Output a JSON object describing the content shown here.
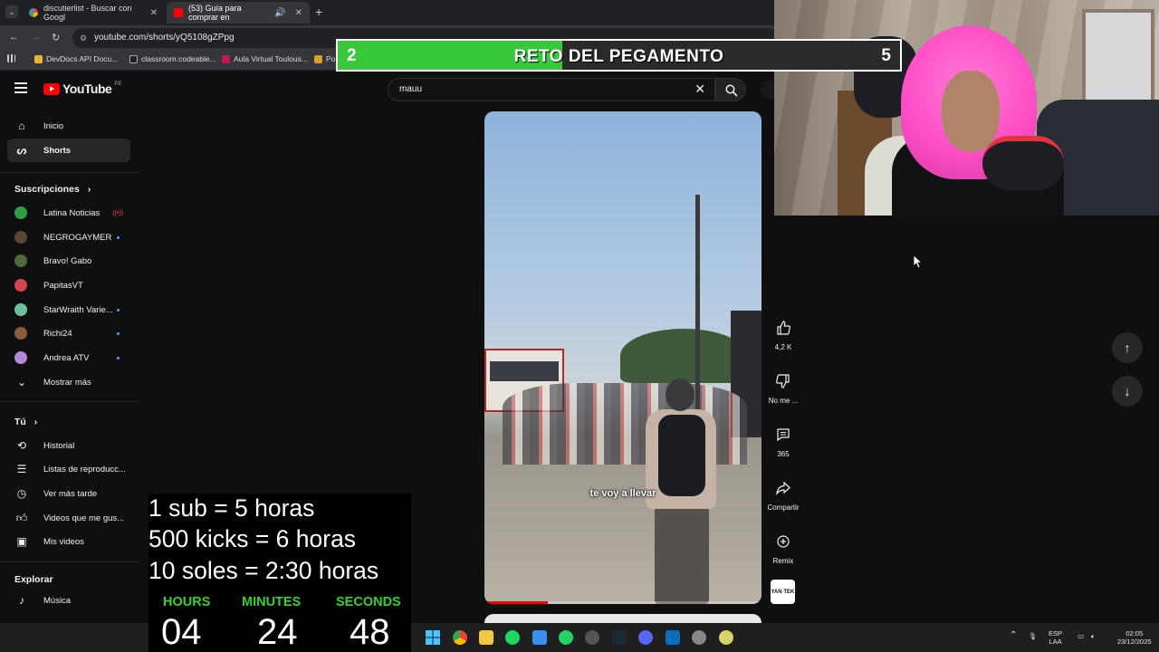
{
  "browser": {
    "tabs": [
      {
        "title": "discutierlist - Buscar con Googl",
        "active": false
      },
      {
        "title": "(53) Guía para comprar en",
        "active": true
      }
    ],
    "url": "youtube.com/shorts/yQ5108gZPpg",
    "bookmarks": [
      "DevDocs API Docu...",
      "classroom.codeable...",
      "Aula Virtual Toulous...",
      "Po"
    ]
  },
  "youtube": {
    "logo_text": "YouTube",
    "country_code": "PE",
    "search_value": "mauu",
    "sidebar": {
      "main": [
        {
          "label": "Inicio",
          "icon": "home-icon",
          "active": false
        },
        {
          "label": "Shorts",
          "icon": "shorts-icon",
          "active": true
        }
      ],
      "subscriptions_title": "Suscripciones",
      "subscriptions": [
        {
          "label": "Latina Noticias",
          "color": "#2ea043",
          "status": "live"
        },
        {
          "label": "NEGROGAYMER",
          "color": "#5a4536",
          "status": "dot"
        },
        {
          "label": "Bravo! Gabo",
          "color": "#4e6a3a",
          "status": ""
        },
        {
          "label": "PapitasVT",
          "color": "#d4454f",
          "status": ""
        },
        {
          "label": "StarWraith Varie...",
          "color": "#6cc0a0",
          "status": "dot"
        },
        {
          "label": "Richi24",
          "color": "#8a5a3a",
          "status": "dot"
        },
        {
          "label": "Andrea ATV",
          "color": "#b38ad6",
          "status": "dot"
        }
      ],
      "show_more": "Mostrar más",
      "you_title": "Tú",
      "you_items": [
        {
          "label": "Historial",
          "icon": "history-icon"
        },
        {
          "label": "Listas de reproducc...",
          "icon": "playlists-icon"
        },
        {
          "label": "Ver más tarde",
          "icon": "watch-later-icon"
        },
        {
          "label": "Videos que me gus...",
          "icon": "liked-icon"
        },
        {
          "label": "Mis videos",
          "icon": "my-videos-icon"
        }
      ],
      "explore_title": "Explorar",
      "explore_items": [
        {
          "label": "Música",
          "icon": "music-icon"
        }
      ]
    },
    "short": {
      "subtitle": "te voy a llevar",
      "progress": 0.23
    },
    "actions": {
      "likes": "4,2 K",
      "dislike": "No me ...",
      "comments": "365",
      "share": "Compartir",
      "remix": "Remix",
      "remix_thumb": "YAN TEK"
    }
  },
  "overlay": {
    "challenge": {
      "left_value": "2",
      "title": "RETO DEL PEGAMENTO",
      "right_value": "5",
      "progress": 0.4
    },
    "donations": [
      "1 sub = 5 horas",
      "500 kicks = 6 horas",
      "10 soles = 2:30 horas"
    ],
    "timer": {
      "hours_label": "HOURS",
      "minutes_label": "MINUTES",
      "seconds_label": "SECONDS",
      "hours": "04",
      "minutes": "24",
      "seconds": "48"
    }
  },
  "taskbar": {
    "lang_top": "ESP",
    "lang_bottom": "LAA",
    "time": "02:05",
    "date": "23/12/2025"
  }
}
